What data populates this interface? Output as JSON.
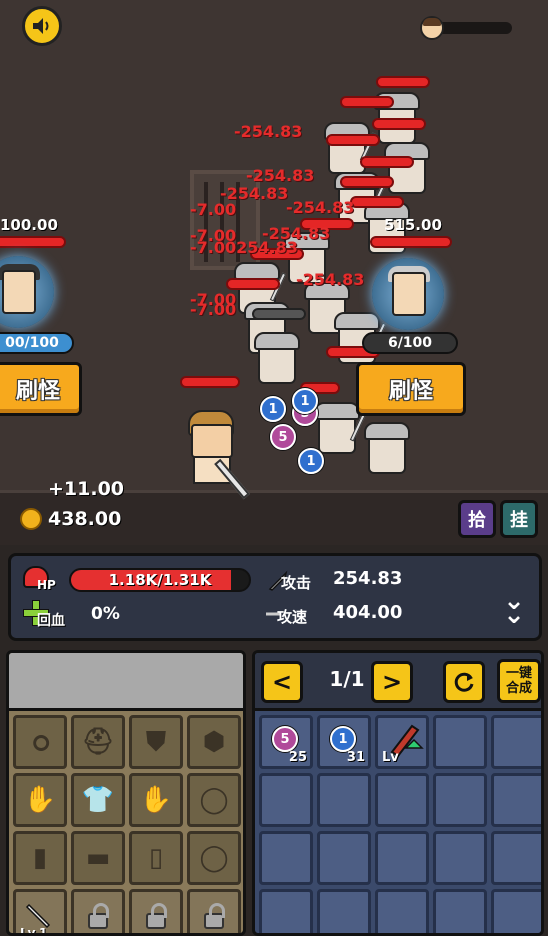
{
  "top": {
    "sound_icon": "speaker-icon",
    "progress_icon": "player-head-icon"
  },
  "player_side": {
    "hp_number": "100.00",
    "counter": "00/100",
    "spawn_label": "刷怪"
  },
  "enemy_side": {
    "hp_number": "515.00",
    "counter": "6/100",
    "spawn_label": "刷怪"
  },
  "damage_numbers": [
    "-254.83",
    "-254.83",
    "-254.83",
    "-7.00",
    "-254.83",
    "-254.83",
    "-7.00",
    "-7.00254.83",
    "-254.83",
    "-7.00",
    "-7.00"
  ],
  "gems_on_field": [
    "1",
    "5",
    "5",
    "1",
    "1"
  ],
  "gold": {
    "gain": "+11.00",
    "total": "438.00"
  },
  "toggles": {
    "pickup": "拾",
    "idle": "挂"
  },
  "stats": {
    "hp_icon_label": "HP",
    "hp_text": "1.18K/1.31K",
    "hp_fraction": 0.9,
    "regen_label": "回血",
    "regen_value": "0%",
    "attack_label": "攻击",
    "attack_value": "254.83",
    "speed_label": "攻速",
    "speed_value": "404.00",
    "expand_icon": "double-chevron-down-icon"
  },
  "equipment": {
    "slots": [
      {
        "icon": "necklace-icon",
        "glyph": "ഠ"
      },
      {
        "icon": "helmet-icon",
        "glyph": "⛑"
      },
      {
        "icon": "shield-icon",
        "glyph": "⛊"
      },
      {
        "icon": "gem-icon",
        "glyph": "⬢"
      },
      {
        "icon": "glove-icon",
        "glyph": "✋"
      },
      {
        "icon": "armor-icon",
        "glyph": "👕"
      },
      {
        "icon": "glove-icon",
        "glyph": "✋"
      },
      {
        "icon": "ring-icon",
        "glyph": "◯"
      },
      {
        "icon": "boot-icon",
        "glyph": "▮"
      },
      {
        "icon": "pants-icon",
        "glyph": "▬"
      },
      {
        "icon": "bracer-icon",
        "glyph": "▯"
      },
      {
        "icon": "ring-icon",
        "glyph": "◯"
      }
    ],
    "weapon_level": "Lv.1"
  },
  "bag": {
    "page": "1/1",
    "prev": "<",
    "next": ">",
    "refresh_icon": "refresh-icon",
    "merge_label": "一键合成",
    "items": [
      {
        "gem": "5",
        "count": "25",
        "color": "purple"
      },
      {
        "gem": "1",
        "count": "31",
        "color": "blue"
      },
      {
        "weapon": "Lv"
      }
    ]
  }
}
